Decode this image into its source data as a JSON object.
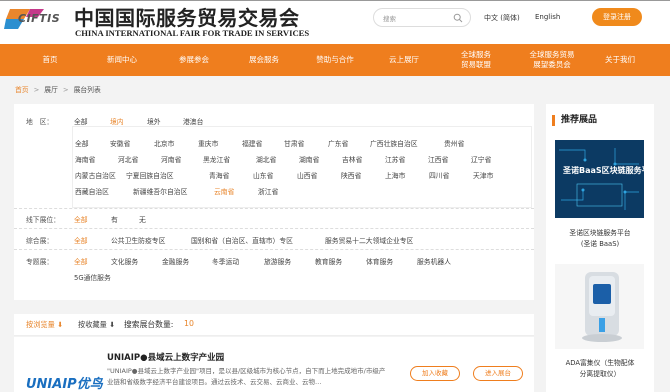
{
  "header": {
    "logo_text": "CIFTIS",
    "title_cn": "中国国际服务贸易交易会",
    "title_en": "CHINA INTERNATIONAL FAIR FOR TRADE IN SERVICES",
    "search_placeholder": "搜索",
    "lang_cn": "中文 (简体)",
    "lang_en": "English",
    "login_label": "登录注册"
  },
  "nav": {
    "items": [
      "首页",
      "新闻中心",
      "参展参会",
      "展会服务",
      "赞助与合作",
      "云上展厅",
      "全球服务\n贸易联盟",
      "全球服务贸易\n展望委员会",
      "关于我们"
    ]
  },
  "breadcrumb": {
    "items": [
      "首页",
      "展厅",
      "展台列表"
    ],
    "separator": ">"
  },
  "filters": {
    "region_label": "地　区：",
    "region_tabs": [
      "全部",
      "境内",
      "境外",
      "港澳台"
    ],
    "provinces": [
      [
        "全部",
        "安徽省",
        "北京市",
        "重庆市",
        "福建省",
        "甘肃省",
        "广东省",
        "广西壮族自治区",
        "贵州省"
      ],
      [
        "海南省",
        "河北省",
        "河南省",
        "黑龙江省",
        "湖北省",
        "湖南省",
        "吉林省",
        "江苏省",
        "江西省",
        "辽宁省"
      ],
      [
        "内蒙古自治区",
        "宁夏回族自治区",
        "青海省",
        "山东省",
        "山西省",
        "陕西省",
        "上海市",
        "四川省",
        "天津市"
      ],
      [
        "西藏自治区",
        "新疆维吾尔自治区",
        "云南省",
        "浙江省"
      ]
    ],
    "offline_label": "线下展位：",
    "offline_options": [
      "全部",
      "有",
      "无"
    ],
    "comprehensive_label": "综合展：",
    "comprehensive_options": [
      "全部",
      "公共卫生防疫专区",
      "国别和省（自治区、直辖市）专区",
      "服务贸易十二大领域企业专区"
    ],
    "special_label": "专题展：",
    "special_options": [
      "全部",
      "文化服务",
      "金融服务",
      "冬季运动",
      "旅游服务",
      "教育服务",
      "体育服务",
      "服务机器人",
      "5G通信服务"
    ]
  },
  "sortbar": {
    "browse_label": "按浏览量",
    "favorite_label": "按收藏量",
    "count_label": "搜索展台数量:",
    "count_value": "10"
  },
  "result": {
    "logo_text": "UNIAIP优鸟",
    "title": "UNIAIP●县域云上数字产业园",
    "description": "\"UNIAIP●县域云上数字产业园\"项目，是以县/区级城市为核心节点，自下而上地完成地市/市级产业链和省级数字经济平台建设项目。通过云技术、云交易、云商业、云物…",
    "favorite_button": "加入收藏",
    "enter_button": "进入展台"
  },
  "sidebar": {
    "title": "推荐展品",
    "card1_text": "圣诺BaaS区块链服务平台",
    "card1_caption": "圣诺区块链服务平台\n(圣诺 BaaS)",
    "card2_caption": "ADA富集仪（生物配体\n分离提取仪）"
  },
  "colors": {
    "accent": "#ef7e1e",
    "active_text": "#e8852b"
  }
}
